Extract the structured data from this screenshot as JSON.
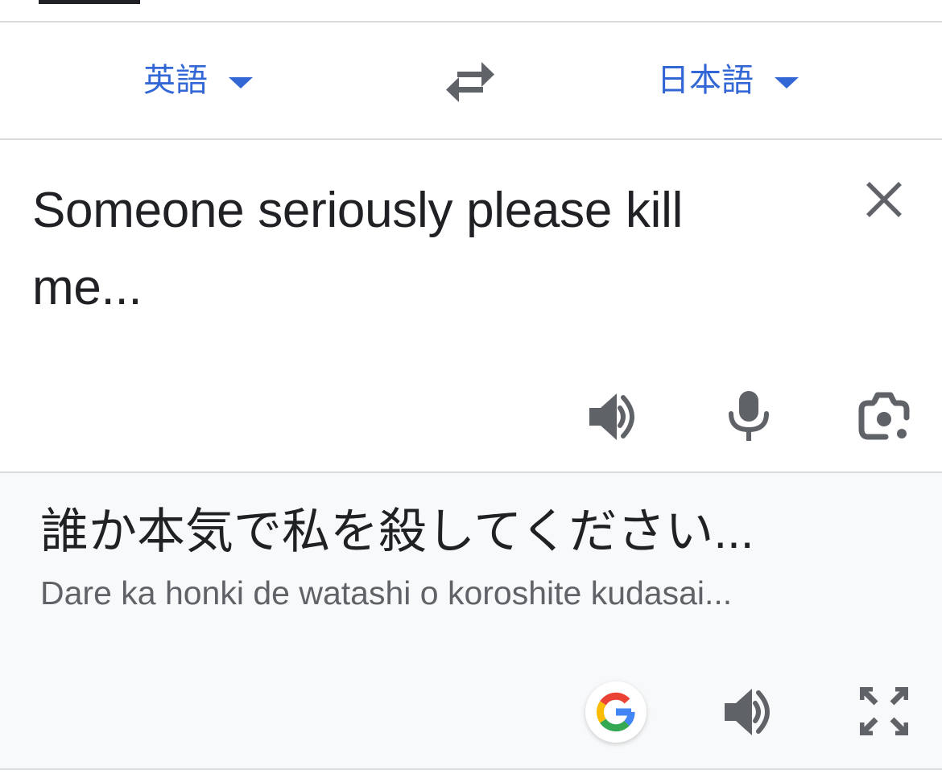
{
  "languages": {
    "source": "英語",
    "target": "日本語"
  },
  "input": {
    "text": "Someone seriously please kill me..."
  },
  "output": {
    "translation": "誰か本気で私を殺してください...",
    "romanization": "Dare ka honki de watashi o koroshite kudasai..."
  },
  "icons": {
    "swap": "swap-arrows-icon",
    "clear": "close-icon",
    "speak_source": "speaker-icon",
    "mic": "microphone-icon",
    "camera": "camera-lens-icon",
    "google": "google-logo-icon",
    "speak_target": "speaker-icon",
    "fullscreen": "fullscreen-icon"
  },
  "colors": {
    "accent": "#3367d6",
    "text": "#202124",
    "secondary_text": "#5f6368",
    "icon": "#5f6368",
    "output_bg": "#f8f9fa",
    "divider": "#dadce0"
  }
}
